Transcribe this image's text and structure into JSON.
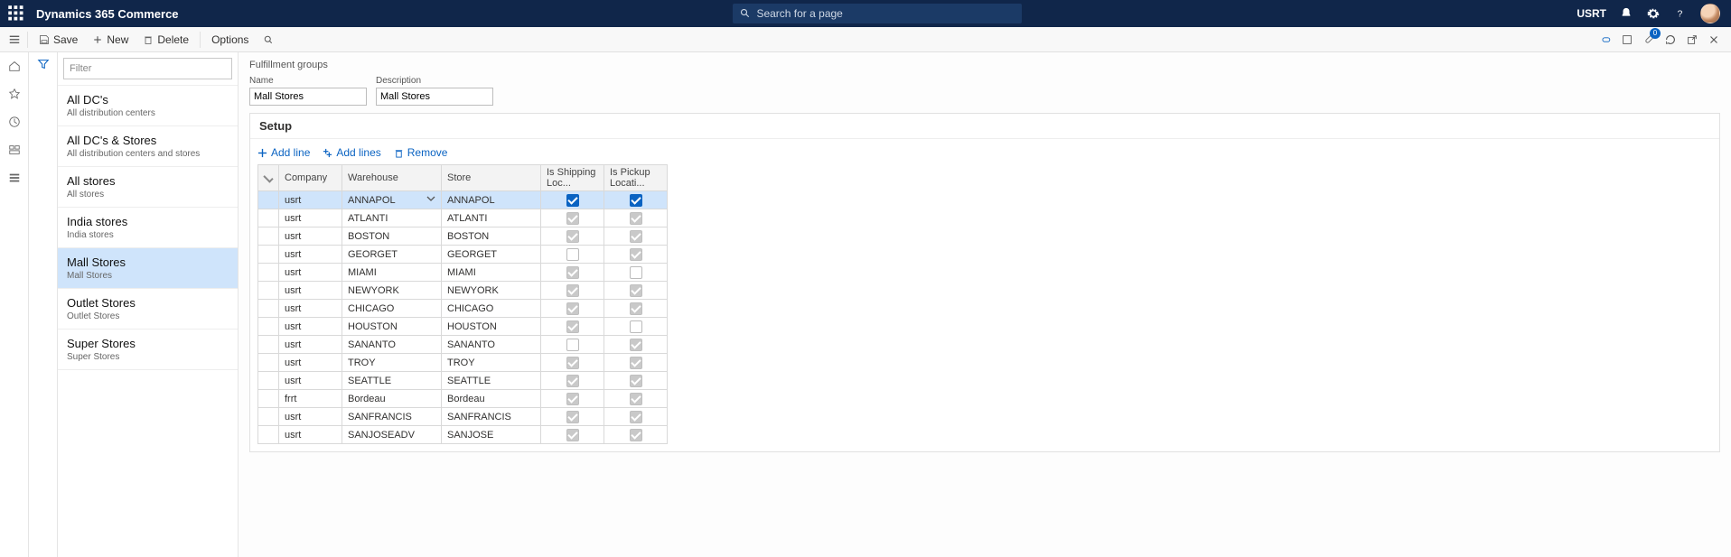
{
  "header": {
    "app_title": "Dynamics 365 Commerce",
    "search_placeholder": "Search for a page",
    "company": "USRT"
  },
  "action_bar": {
    "save": "Save",
    "new": "New",
    "delete": "Delete",
    "options": "Options",
    "badge": "0"
  },
  "nav": {
    "filter_placeholder": "Filter",
    "items": [
      {
        "title": "All DC's",
        "subtitle": "All distribution centers"
      },
      {
        "title": "All DC's & Stores",
        "subtitle": "All distribution centers and stores"
      },
      {
        "title": "All stores",
        "subtitle": "All stores"
      },
      {
        "title": "India stores",
        "subtitle": "India stores"
      },
      {
        "title": "Mall Stores",
        "subtitle": "Mall Stores"
      },
      {
        "title": "Outlet Stores",
        "subtitle": "Outlet Stores"
      },
      {
        "title": "Super Stores",
        "subtitle": "Super Stores"
      }
    ],
    "selected_index": 4
  },
  "main": {
    "breadcrumb": "Fulfillment groups",
    "name_label": "Name",
    "name_value": "Mall Stores",
    "desc_label": "Description",
    "desc_value": "Mall Stores",
    "setup_label": "Setup",
    "actions": {
      "add_line": "Add line",
      "add_lines": "Add lines",
      "remove": "Remove"
    },
    "columns": {
      "company": "Company",
      "warehouse": "Warehouse",
      "store": "Store",
      "shipping": "Is Shipping Loc...",
      "pickup": "Is Pickup Locati..."
    },
    "rows": [
      {
        "company": "usrt",
        "warehouse": "ANNAPOL",
        "store": "ANNAPOL",
        "ship": "checked",
        "pick": "checked",
        "selected": true
      },
      {
        "company": "usrt",
        "warehouse": "ATLANTI",
        "store": "ATLANTI",
        "ship": "disabled-checked",
        "pick": "disabled-checked"
      },
      {
        "company": "usrt",
        "warehouse": "BOSTON",
        "store": "BOSTON",
        "ship": "disabled-checked",
        "pick": "disabled-checked"
      },
      {
        "company": "usrt",
        "warehouse": "GEORGET",
        "store": "GEORGET",
        "ship": "unchecked",
        "pick": "disabled-checked"
      },
      {
        "company": "usrt",
        "warehouse": "MIAMI",
        "store": "MIAMI",
        "ship": "disabled-checked",
        "pick": "unchecked"
      },
      {
        "company": "usrt",
        "warehouse": "NEWYORK",
        "store": "NEWYORK",
        "ship": "disabled-checked",
        "pick": "disabled-checked"
      },
      {
        "company": "usrt",
        "warehouse": "CHICAGO",
        "store": "CHICAGO",
        "ship": "disabled-checked",
        "pick": "disabled-checked"
      },
      {
        "company": "usrt",
        "warehouse": "HOUSTON",
        "store": "HOUSTON",
        "ship": "disabled-checked",
        "pick": "unchecked"
      },
      {
        "company": "usrt",
        "warehouse": "SANANTO",
        "store": "SANANTO",
        "ship": "unchecked",
        "pick": "disabled-checked"
      },
      {
        "company": "usrt",
        "warehouse": "TROY",
        "store": "TROY",
        "ship": "disabled-checked",
        "pick": "disabled-checked"
      },
      {
        "company": "usrt",
        "warehouse": "SEATTLE",
        "store": "SEATTLE",
        "ship": "disabled-checked",
        "pick": "disabled-checked"
      },
      {
        "company": "frrt",
        "warehouse": "Bordeau",
        "store": "Bordeau",
        "ship": "disabled-checked",
        "pick": "disabled-checked"
      },
      {
        "company": "usrt",
        "warehouse": "SANFRANCIS",
        "store": "SANFRANCIS",
        "ship": "disabled-checked",
        "pick": "disabled-checked"
      },
      {
        "company": "usrt",
        "warehouse": "SANJOSEADV",
        "store": "SANJOSE",
        "ship": "disabled-checked",
        "pick": "disabled-checked"
      }
    ]
  }
}
